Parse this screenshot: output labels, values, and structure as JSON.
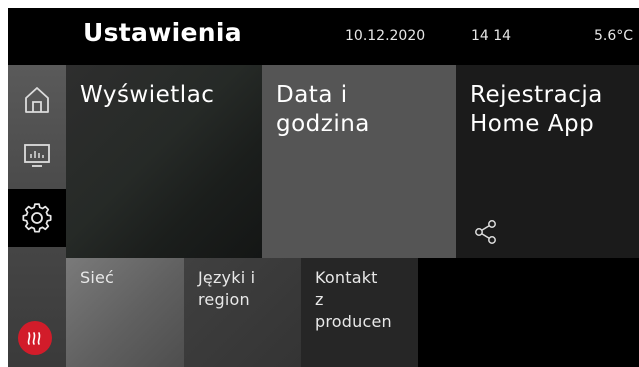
{
  "header": {
    "title": "Ustawienia",
    "date": "10.12.2020",
    "time": "14 14",
    "temperature": "5.6°C"
  },
  "sidebar": {
    "items": [
      {
        "icon": "home-icon"
      },
      {
        "icon": "display-chart-icon"
      },
      {
        "icon": "gear-icon",
        "active": true
      },
      {
        "icon": "brand-logo-icon"
      }
    ]
  },
  "tiles": {
    "display": "Wyświetlac",
    "date_time": "Data i\ngodzina",
    "registration": "Rejestracja\nHome App",
    "registration_icon": "share-icon",
    "network": "Sieć",
    "languages": "Języki i\nregion",
    "contact": "Kontakt\nz\nproducen"
  },
  "colors": {
    "background": "#000000",
    "logo_red": "#d21c2a",
    "tile_date": "#555555"
  }
}
